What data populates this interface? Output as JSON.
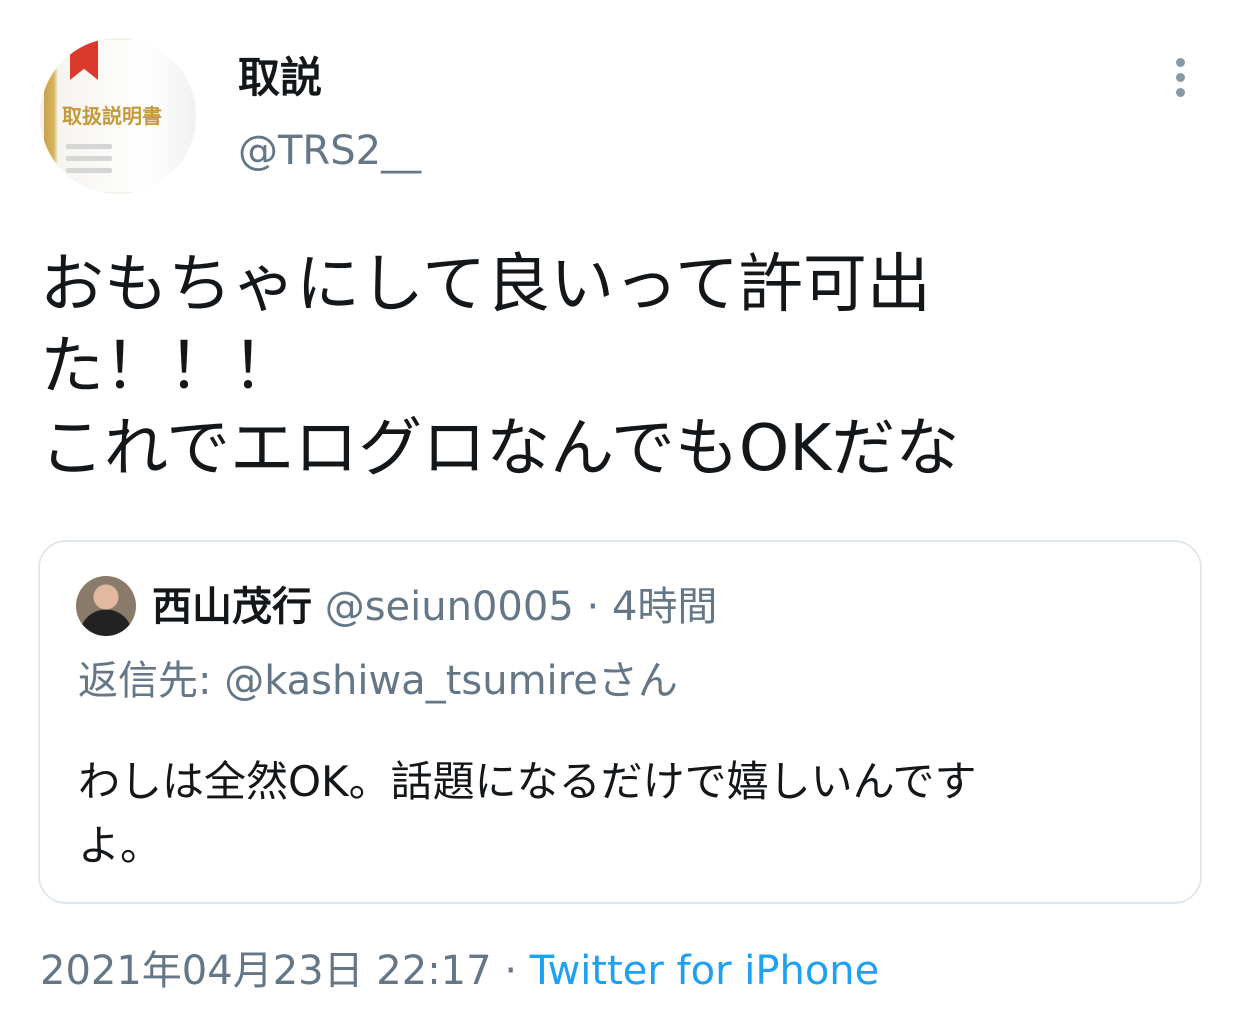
{
  "author": {
    "display_name": "取説",
    "handle": "@TRS2__",
    "avatar_text": "取扱説明書"
  },
  "tweet": {
    "lines": [
      "おもちゃにして良いって許可出",
      "た！！！",
      "これでエログロなんでもOKだな"
    ]
  },
  "quoted": {
    "display_name": "西山茂行",
    "handle": "@seiun0005",
    "separator": "·",
    "time": "4時間",
    "reply_to": "返信先: @kashiwa_tsumireさん",
    "lines": [
      "わしは全然OK。話題になるだけで嬉しいんです",
      "よ。"
    ]
  },
  "footer": {
    "date": "2021年04月23日 22:17",
    "separator": "·",
    "source": "Twitter for iPhone"
  },
  "icons": {
    "more": "vertical-ellipsis-icon"
  },
  "colors": {
    "text": "#14171a",
    "secondary": "#657786",
    "link": "#1da1f2",
    "border": "#e1e8ed"
  }
}
